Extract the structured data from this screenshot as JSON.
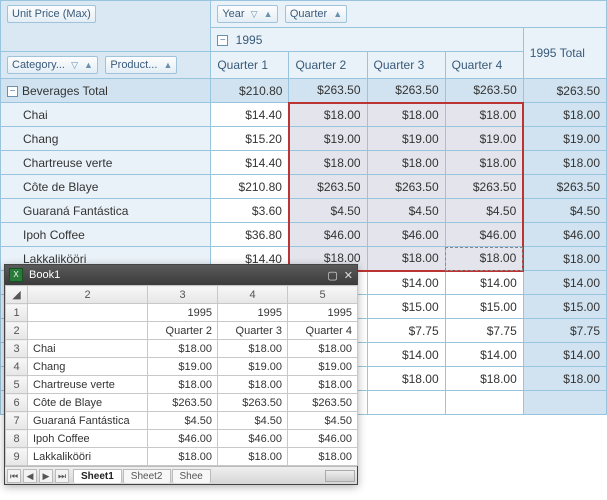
{
  "pivot": {
    "data_field_label": "Unit Price (Max)",
    "col_fields": [
      "Year",
      "Quarter"
    ],
    "row_fields": [
      "Category...",
      "Product..."
    ],
    "group_label": "1995",
    "total_col_label": "1995 Total",
    "quarter_headers": [
      "Quarter 1",
      "Quarter 2",
      "Quarter 3",
      "Quarter 4"
    ],
    "rows": [
      {
        "label": "Beverages Total",
        "type": "total",
        "indent": 0,
        "values": [
          "$210.80",
          "$263.50",
          "$263.50",
          "$263.50"
        ],
        "total": "$263.50"
      },
      {
        "label": "Chai",
        "indent": 1,
        "values": [
          "$14.40",
          "$18.00",
          "$18.00",
          "$18.00"
        ],
        "total": "$18.00"
      },
      {
        "label": "Chang",
        "indent": 1,
        "values": [
          "$15.20",
          "$19.00",
          "$19.00",
          "$19.00"
        ],
        "total": "$19.00"
      },
      {
        "label": "Chartreuse verte",
        "indent": 1,
        "values": [
          "$14.40",
          "$18.00",
          "$18.00",
          "$18.00"
        ],
        "total": "$18.00"
      },
      {
        "label": "Côte de Blaye",
        "indent": 1,
        "values": [
          "$210.80",
          "$263.50",
          "$263.50",
          "$263.50"
        ],
        "total": "$263.50"
      },
      {
        "label": "Guaraná Fantástica",
        "indent": 1,
        "values": [
          "$3.60",
          "$4.50",
          "$4.50",
          "$4.50"
        ],
        "total": "$4.50"
      },
      {
        "label": "Ipoh Coffee",
        "indent": 1,
        "values": [
          "$36.80",
          "$46.00",
          "$46.00",
          "$46.00"
        ],
        "total": "$46.00"
      },
      {
        "label": "Lakkalikööri",
        "indent": 1,
        "values": [
          "$14.40",
          "$18.00",
          "$18.00",
          "$18.00"
        ],
        "total": "$18.00"
      },
      {
        "label": "",
        "indent": 1,
        "values": [
          "",
          "",
          "$14.00",
          "$14.00"
        ],
        "total": "$14.00"
      },
      {
        "label": "",
        "indent": 1,
        "values": [
          "",
          "",
          "$15.00",
          "$15.00"
        ],
        "total": "$15.00"
      },
      {
        "label": "",
        "indent": 1,
        "values": [
          "",
          "",
          "$7.75",
          "$7.75"
        ],
        "total": "$7.75"
      },
      {
        "label": "",
        "indent": 1,
        "values": [
          "",
          "",
          "$14.00",
          "$14.00"
        ],
        "total": "$14.00"
      },
      {
        "label": "",
        "indent": 1,
        "values": [
          "",
          "",
          "$18.00",
          "$18.00"
        ],
        "total": "$18.00"
      },
      {
        "label": "",
        "indent": 1,
        "values": [
          "",
          "",
          "",
          ""
        ],
        "total": ""
      }
    ],
    "selection": {
      "row_start": 1,
      "row_end": 7,
      "col_start": 1,
      "col_end": 3
    },
    "focus_cell": {
      "row": 7,
      "col": 3
    }
  },
  "excel": {
    "title": "Book1",
    "col_headers": [
      "2",
      "3",
      "4",
      "5"
    ],
    "rows": [
      {
        "r": "1",
        "c": [
          "",
          "1995",
          "1995",
          "1995"
        ]
      },
      {
        "r": "2",
        "c": [
          "",
          "Quarter 2",
          "Quarter 3",
          "Quarter 4"
        ]
      },
      {
        "r": "3",
        "c": [
          "Chai",
          "$18.00",
          "$18.00",
          "$18.00"
        ]
      },
      {
        "r": "4",
        "c": [
          "Chang",
          "$19.00",
          "$19.00",
          "$19.00"
        ]
      },
      {
        "r": "5",
        "c": [
          "Chartreuse verte",
          "$18.00",
          "$18.00",
          "$18.00"
        ]
      },
      {
        "r": "6",
        "c": [
          "Côte de Blaye",
          "$263.50",
          "$263.50",
          "$263.50"
        ]
      },
      {
        "r": "7",
        "c": [
          "Guaraná Fantástica",
          "$4.50",
          "$4.50",
          "$4.50"
        ]
      },
      {
        "r": "8",
        "c": [
          "Ipoh Coffee",
          "$46.00",
          "$46.00",
          "$46.00"
        ]
      },
      {
        "r": "9",
        "c": [
          "Lakkalikööri",
          "$18.00",
          "$18.00",
          "$18.00"
        ]
      }
    ],
    "tabs": [
      "Sheet1",
      "Sheet2",
      "Shee"
    ],
    "active_tab": 0
  }
}
